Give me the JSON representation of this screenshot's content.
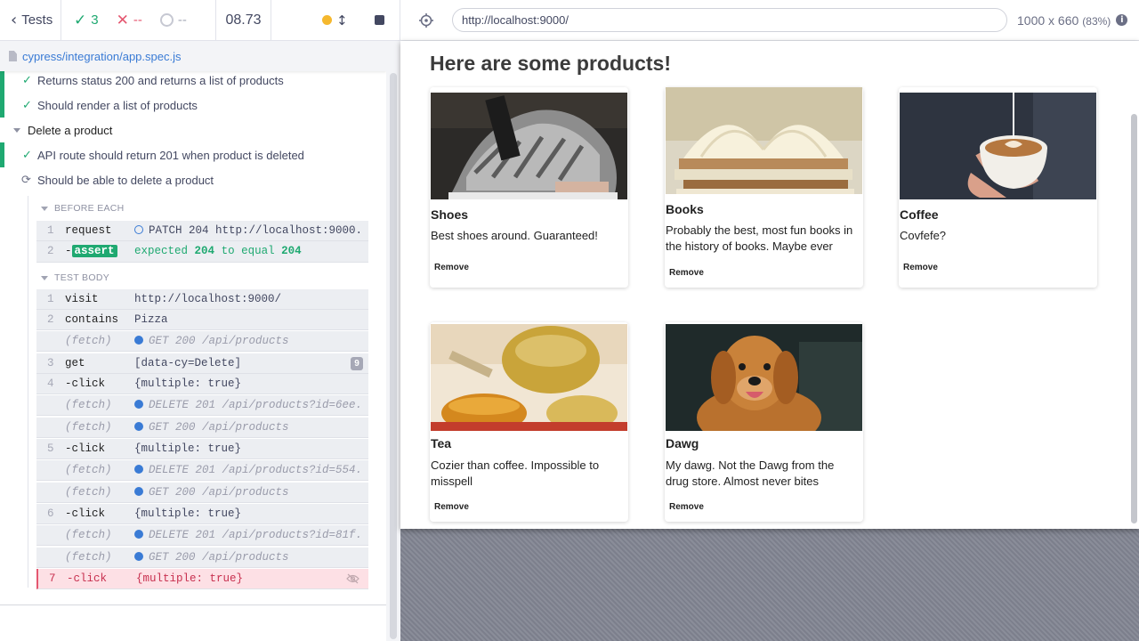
{
  "reporter_header": {
    "tests_label": "Tests",
    "passed_count": "3",
    "failed_count": "--",
    "pending_count": "--",
    "duration": "08.73"
  },
  "url_bar": {
    "url": "http://localhost:9000/",
    "viewport": "1000 x 660",
    "scale": "(83%)"
  },
  "spec": {
    "path": "cypress/integration/app.spec.js"
  },
  "tests": {
    "t1": "Returns status 200 and returns a list of products",
    "t2": "Should render a list of products",
    "suite": "Delete a product",
    "t3": "API route should return 201 when product is deleted",
    "t4": "Should be able to delete a product"
  },
  "hooks": {
    "before_each": "BEFORE EACH",
    "test_body": "TEST BODY"
  },
  "before_each_cmds": [
    {
      "num": "1",
      "name": "request",
      "msg": "PATCH 204 http://localhost:9000..."
    },
    {
      "num": "2",
      "name": "-",
      "badge": "assert",
      "msg_pre": "expected",
      "v1": "204",
      "mid": "to equal",
      "v2": "204"
    }
  ],
  "body_cmds": [
    {
      "num": "1",
      "name": "visit",
      "msg": "http://localhost:9000/"
    },
    {
      "num": "2",
      "name": "contains",
      "msg": "Pizza"
    },
    {
      "num": "",
      "name": "(fetch)",
      "msg": "GET 200 /api/products"
    },
    {
      "num": "3",
      "name": "get",
      "msg": "[data-cy=Delete]",
      "count": "9"
    },
    {
      "num": "4",
      "name": "-click",
      "msg": "{multiple: true}"
    },
    {
      "num": "",
      "name": "(fetch)",
      "msg": "DELETE 201 /api/products?id=6ee..."
    },
    {
      "num": "",
      "name": "(fetch)",
      "msg": "GET 200 /api/products"
    },
    {
      "num": "5",
      "name": "-click",
      "msg": "{multiple: true}"
    },
    {
      "num": "",
      "name": "(fetch)",
      "msg": "DELETE 201 /api/products?id=554..."
    },
    {
      "num": "",
      "name": "(fetch)",
      "msg": "GET 200 /api/products"
    },
    {
      "num": "6",
      "name": "-click",
      "msg": "{multiple: true}"
    },
    {
      "num": "",
      "name": "(fetch)",
      "msg": "DELETE 201 /api/products?id=81f..."
    },
    {
      "num": "",
      "name": "(fetch)",
      "msg": "GET 200 /api/products"
    },
    {
      "num": "7",
      "name": "-click",
      "msg": "{multiple: true}"
    }
  ],
  "app": {
    "heading": "Here are some products!",
    "remove_label": "Remove",
    "products": [
      {
        "title": "Shoes",
        "desc": "Best shoes around. Guaranteed!"
      },
      {
        "title": "Books",
        "desc": "Probably the best, most fun books in the history of books. Maybe ever"
      },
      {
        "title": "Coffee",
        "desc": "Covfefe?"
      },
      {
        "title": "Tea",
        "desc": "Cozier than coffee. Impossible to misspell"
      },
      {
        "title": "Dawg",
        "desc": "My dawg. Not the Dawg from the drug store. Almost never bites"
      }
    ]
  },
  "colors": {
    "pass": "#1fa971",
    "fail": "#e45770",
    "link": "#3a7bd5"
  }
}
